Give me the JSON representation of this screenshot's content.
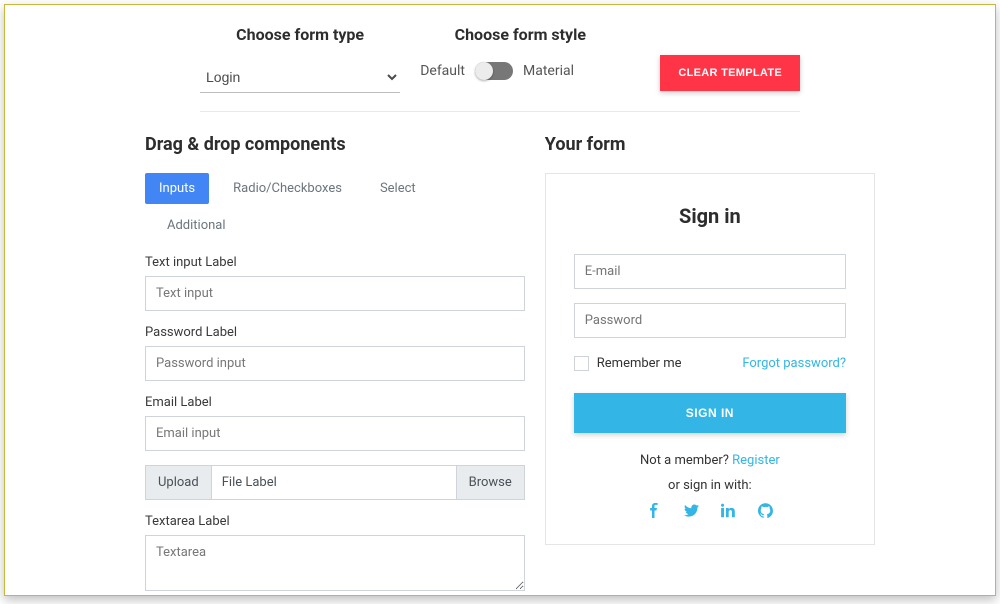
{
  "top": {
    "form_type_label": "Choose form type",
    "form_type_value": "Login",
    "form_style_label": "Choose form style",
    "style_left": "Default",
    "style_right": "Material",
    "clear_button": "CLEAR TEMPLATE"
  },
  "left": {
    "title": "Drag & drop components",
    "tabs": {
      "inputs": "Inputs",
      "radio": "Radio/Checkboxes",
      "select": "Select",
      "additional": "Additional"
    },
    "fields": {
      "text_label": "Text input Label",
      "text_ph": "Text input",
      "password_label": "Password Label",
      "password_ph": "Password input",
      "email_label": "Email Label",
      "email_ph": "Email input",
      "upload": "Upload",
      "file_label": "File Label",
      "browse": "Browse",
      "textarea_label": "Textarea Label",
      "textarea_ph": "Textarea"
    }
  },
  "right": {
    "title": "Your form",
    "card_title": "Sign in",
    "email_ph": "E-mail",
    "password_ph": "Password",
    "remember": "Remember me",
    "forgot": "Forgot password?",
    "signin_btn": "SIGN IN",
    "not_member": "Not a member? ",
    "register": "Register",
    "or_signin": "or sign in with:"
  }
}
